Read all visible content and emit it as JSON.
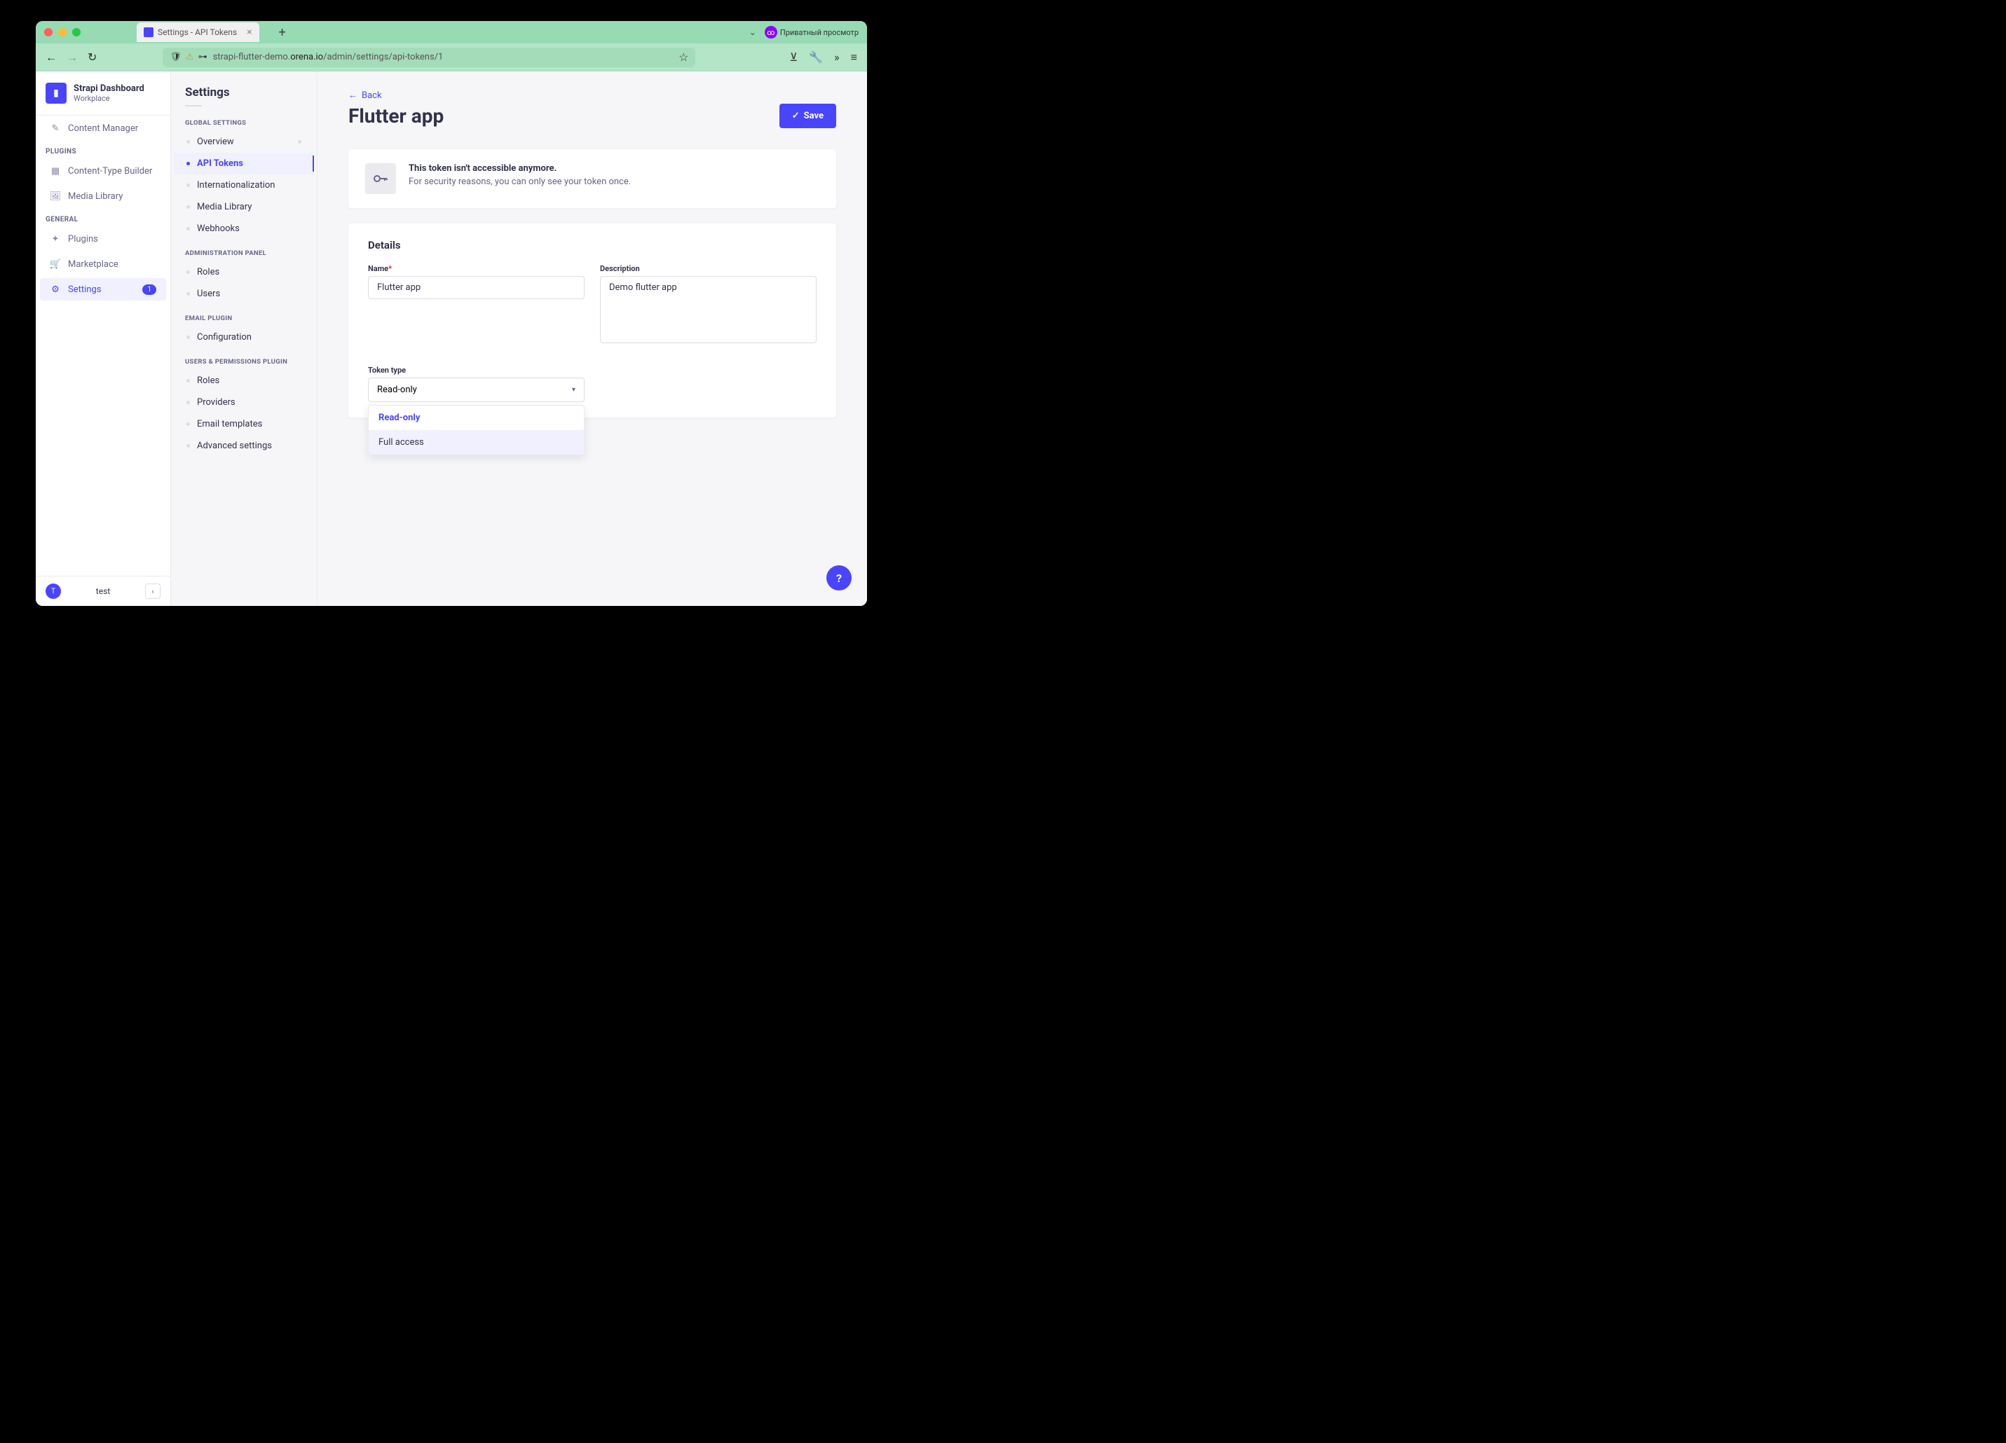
{
  "browser": {
    "tab_title": "Settings - API Tokens",
    "private_label": "Приватный просмотр",
    "url_prefix": "strapi-flutter-demo.",
    "url_domain": "orena.io",
    "url_path": "/admin/settings/api-tokens/1"
  },
  "nav": {
    "title": "Strapi Dashboard",
    "subtitle": "Workplace",
    "content_manager": "Content Manager",
    "plugins_label": "PLUGINS",
    "content_type_builder": "Content-Type Builder",
    "media_library": "Media Library",
    "general_label": "GENERAL",
    "plugins": "Plugins",
    "marketplace": "Marketplace",
    "settings": "Settings",
    "settings_badge": "1",
    "user_initial": "T",
    "user_name": "test"
  },
  "settings_sidebar": {
    "title": "Settings",
    "global_label": "GLOBAL SETTINGS",
    "overview": "Overview",
    "api_tokens": "API Tokens",
    "internationalization": "Internationalization",
    "media_library": "Media Library",
    "webhooks": "Webhooks",
    "admin_label": "ADMINISTRATION PANEL",
    "roles": "Roles",
    "users": "Users",
    "email_label": "EMAIL PLUGIN",
    "configuration": "Configuration",
    "perms_label": "USERS & PERMISSIONS PLUGIN",
    "perm_roles": "Roles",
    "providers": "Providers",
    "email_templates": "Email templates",
    "advanced": "Advanced settings"
  },
  "main": {
    "back": "Back",
    "title": "Flutter app",
    "save": "Save",
    "warning_title": "This token isn't accessible anymore.",
    "warning_body": "For security reasons, you can only see your token once.",
    "details_title": "Details",
    "name_label": "Name",
    "name_value": "Flutter app",
    "desc_label": "Description",
    "desc_value": "Demo flutter app",
    "token_type_label": "Token type",
    "token_type_value": "Read-only",
    "options": {
      "readonly": "Read-only",
      "full": "Full access"
    }
  }
}
